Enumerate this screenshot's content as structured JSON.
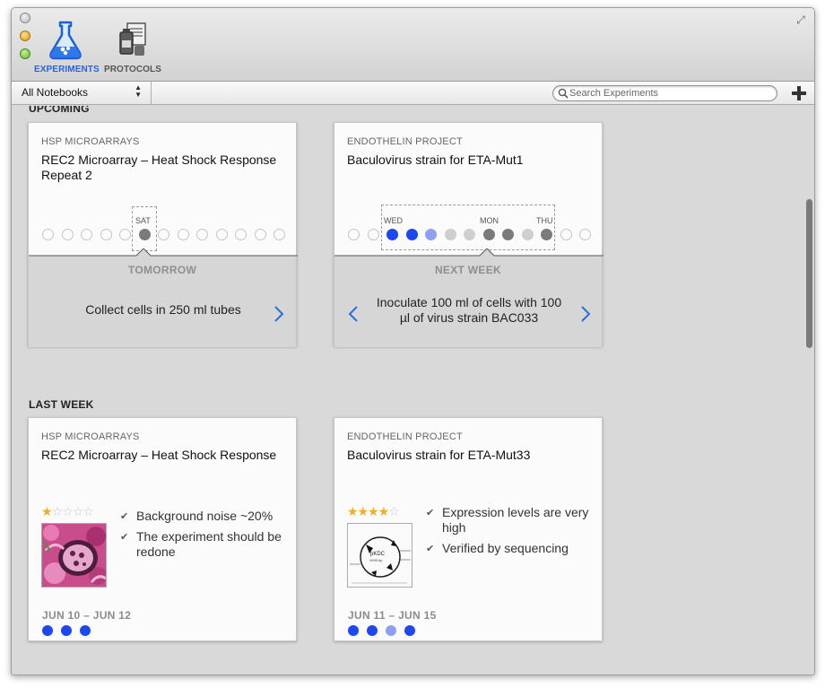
{
  "toolbar": {
    "experiments_label": "EXPERIMENTS",
    "protocols_label": "PROTOCOLS"
  },
  "filter": {
    "notebook": "All Notebooks",
    "search_placeholder": "Search Experiments"
  },
  "colors": {
    "accent": "#2a63d8",
    "dot_blue": "#1d48f0",
    "dot_light_blue": "#8f9ff2",
    "dot_gray": "#7b7b7b",
    "star": "#f4ad1f"
  },
  "sections": {
    "upcoming": "UPCOMING",
    "last_week": "LAST WEEK"
  },
  "upcoming": [
    {
      "project": "HSP MICROARRAYS",
      "title": "REC2 Microarray – Heat Shock Response Repeat 2",
      "day_labels": [
        "SAT"
      ],
      "when": "TOMORROW",
      "step": "Collect cells in 250 ml tubes",
      "dots": [
        "empty",
        "empty",
        "empty",
        "empty",
        "empty",
        "gray",
        "empty",
        "empty",
        "empty",
        "empty",
        "empty",
        "empty",
        "empty"
      ]
    },
    {
      "project": "ENDOTHELIN PROJECT",
      "title": "Baculovirus strain for ETA-Mut1",
      "day_labels": [
        "WED",
        "MON",
        "THU"
      ],
      "when": "NEXT WEEK",
      "step": "Inoculate 100 ml of cells with 100 µl of virus strain BAC033",
      "dots": [
        "empty",
        "empty",
        "blue",
        "blue",
        "lblue",
        "light",
        "light",
        "gray",
        "gray",
        "light",
        "gray",
        "empty",
        "empty"
      ]
    }
  ],
  "last_week": [
    {
      "project": "HSP MICROARRAYS",
      "title": "REC2 Microarray – Heat Shock Response",
      "rating": 1,
      "rating_max": 5,
      "notes": [
        "Background noise ~20%",
        "The experiment should be redone"
      ],
      "date_range": "JUN 10 – JUN 12",
      "dots": [
        "blue",
        "blue",
        "blue"
      ]
    },
    {
      "project": "ENDOTHELIN PROJECT",
      "title": "Baculovirus strain for ETA-Mut33",
      "rating": 4,
      "rating_max": 5,
      "notes": [
        "Expression levels are very high",
        "Verified by sequencing"
      ],
      "date_range": "JUN 11 – JUN 15",
      "dots": [
        "blue",
        "blue",
        "lblue",
        "blue"
      ],
      "plasmid_labels": [
        "pKDC",
        "4995 bp"
      ]
    }
  ]
}
